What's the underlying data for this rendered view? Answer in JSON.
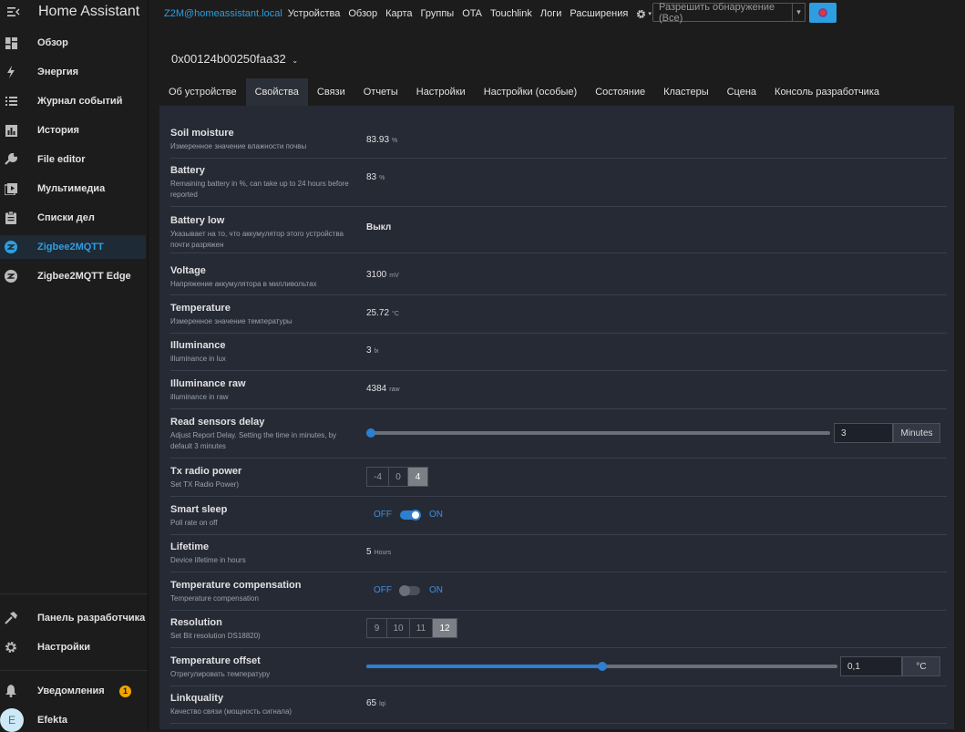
{
  "sidebar": {
    "title": "Home Assistant",
    "items": [
      {
        "label": "Обзор",
        "icon": "dashboard-icon"
      },
      {
        "label": "Энергия",
        "icon": "lightning-icon"
      },
      {
        "label": "Журнал событий",
        "icon": "logbook-icon"
      },
      {
        "label": "История",
        "icon": "chart-icon"
      },
      {
        "label": "File editor",
        "icon": "wrench-icon"
      },
      {
        "label": "Мультимедиа",
        "icon": "media-icon"
      },
      {
        "label": "Списки дел",
        "icon": "clipboard-icon"
      },
      {
        "label": "Zigbee2MQTT",
        "icon": "zigbee-icon"
      },
      {
        "label": "Zigbee2MQTT Edge",
        "icon": "zigbee-icon"
      }
    ],
    "bottom": [
      {
        "label": "Панель разработчика",
        "icon": "hammer-icon"
      },
      {
        "label": "Настройки",
        "icon": "gear-icon"
      }
    ],
    "notifications": {
      "label": "Уведомления",
      "count": "1"
    },
    "user": {
      "label": "Efekta",
      "initial": "E"
    }
  },
  "topnav": {
    "brand": "Z2M@homeassistant.local",
    "links": [
      "Устройства",
      "Обзор",
      "Карта",
      "Группы",
      "OTA",
      "Touchlink",
      "Логи",
      "Расширения"
    ],
    "permit": "Разрешить обнаружение (Все)"
  },
  "device": {
    "name": "0x00124b00250faa32",
    "tabs": [
      "Об устройстве",
      "Свойства",
      "Связи",
      "Отчеты",
      "Настройки",
      "Настройки (особые)",
      "Состояние",
      "Кластеры",
      "Сцена",
      "Консоль разработчика"
    ],
    "active_tab": "Свойства"
  },
  "properties": [
    {
      "name": "Soil moisture",
      "desc": "Измеренное значение влажности почвы",
      "value": "83.93",
      "unit": "%"
    },
    {
      "name": "Battery",
      "desc": "Remaining battery in %, can take up to 24 hours before reported",
      "value": "83",
      "unit": "%"
    },
    {
      "name": "Battery low",
      "desc": "Указывает на то, что аккумулятор этого устройства почти разряжен",
      "value": "Выкл",
      "unit": ""
    },
    {
      "name": "Voltage",
      "desc": "Напряжение аккумулятора в милливольтах",
      "value": "3100",
      "unit": "mV"
    },
    {
      "name": "Temperature",
      "desc": "Измеренное значение температуры",
      "value": "25.72",
      "unit": "°C"
    },
    {
      "name": "Illuminance",
      "desc": "illuminance in lux",
      "value": "3",
      "unit": "lx"
    },
    {
      "name": "Illuminance raw",
      "desc": "illuminance in raw",
      "value": "4384",
      "unit": "raw"
    },
    {
      "name": "Read sensors delay",
      "desc": "Adjust Report Delay. Setting the time in minutes, by default 3 minutes",
      "value": "3",
      "unit": "Minutes",
      "slider_fraction": 0.01
    },
    {
      "name": "Tx radio power",
      "desc": "Set TX Radio Power)",
      "options": [
        "-4",
        "0",
        "4"
      ],
      "selected": "4"
    },
    {
      "name": "Smart sleep",
      "desc": "Poll rate on off",
      "off": "OFF",
      "on": "ON",
      "state": "on"
    },
    {
      "name": "Lifetime",
      "desc": "Device lifetime in hours",
      "value": "5",
      "unit": "Hours"
    },
    {
      "name": "Temperature compensation",
      "desc": "Temperature compensation",
      "off": "OFF",
      "on": "ON",
      "state": "off"
    },
    {
      "name": "Resolution",
      "desc": "Set Bit resolution DS18820)",
      "options": [
        "9",
        "10",
        "11",
        "12"
      ],
      "selected": "12"
    },
    {
      "name": "Temperature offset",
      "desc": "Отрегулировать температуру",
      "value": "0,1",
      "unit": "°C",
      "slider_fraction": 0.5
    },
    {
      "name": "Linkquality",
      "desc": "Качество связи (мощность сигнала)",
      "value": "65",
      "unit": "lqi"
    }
  ]
}
